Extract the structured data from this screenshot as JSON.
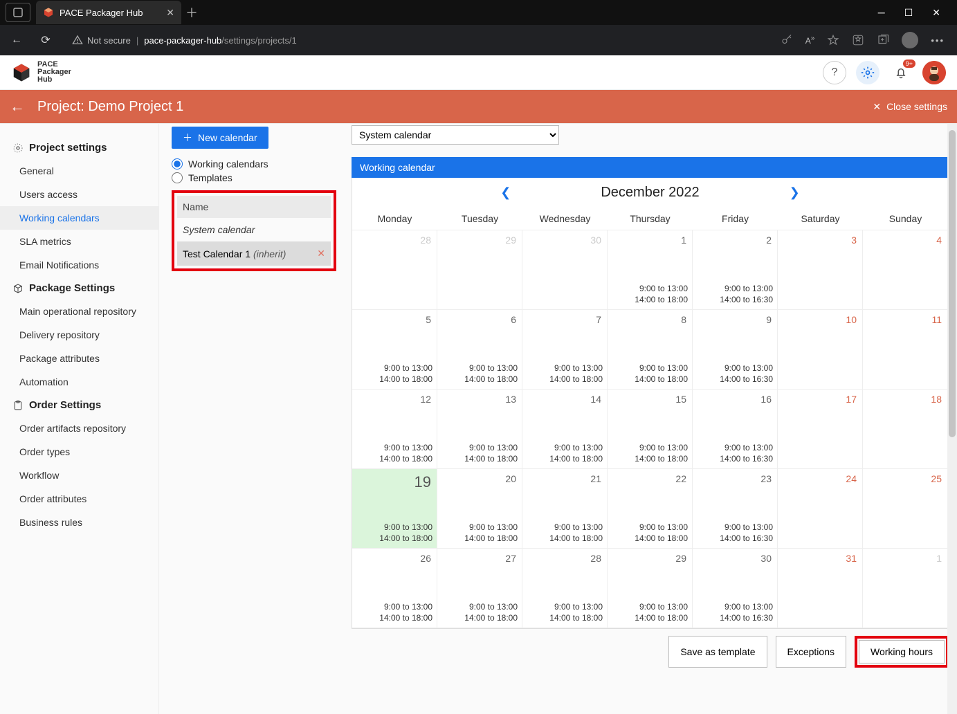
{
  "browser": {
    "tab_title": "PACE Packager Hub",
    "not_secure": "Not secure",
    "url_host": "pace-packager-hub",
    "url_path": "/settings/projects/1"
  },
  "app_header": {
    "brand1": "PACE",
    "brand2": "Packager",
    "brand3": "Hub",
    "notif_badge": "9+"
  },
  "project_bar": {
    "title": "Project: Demo Project 1",
    "close": "Close settings"
  },
  "sidebar": {
    "sec_project": "Project settings",
    "items_project": [
      "General",
      "Users access",
      "Working calendars",
      "SLA metrics",
      "Email Notifications"
    ],
    "sec_package": "Package Settings",
    "items_package": [
      "Main operational repository",
      "Delivery repository",
      "Package attributes",
      "Automation"
    ],
    "sec_order": "Order Settings",
    "items_order": [
      "Order artifacts repository",
      "Order types",
      "Workflow",
      "Order attributes",
      "Business rules"
    ]
  },
  "middle": {
    "new_calendar": "New calendar",
    "radio_working": "Working calendars",
    "radio_templates": "Templates",
    "col_name": "Name",
    "system_calendar": "System calendar",
    "test_calendar": "Test Calendar 1",
    "inherit": "(inherit)"
  },
  "calendar": {
    "selector_value": "System calendar",
    "panel_title": "Working calendar",
    "month_label": "December 2022",
    "days": [
      "Monday",
      "Tuesday",
      "Wednesday",
      "Thursday",
      "Friday",
      "Saturday",
      "Sunday"
    ],
    "slotA": "9:00 to 13:00",
    "slotB": "14:00 to 18:00",
    "slotB_fri": "14:00 to 16:30",
    "save_template": "Save as template",
    "exceptions": "Exceptions",
    "working_hours": "Working hours",
    "cells": [
      {
        "n": "28",
        "cls": "other"
      },
      {
        "n": "29",
        "cls": "other"
      },
      {
        "n": "30",
        "cls": "other"
      },
      {
        "n": "1",
        "cls": "wd th"
      },
      {
        "n": "2",
        "cls": "wd fr"
      },
      {
        "n": "3",
        "cls": "weekend"
      },
      {
        "n": "4",
        "cls": "weekend"
      },
      {
        "n": "5",
        "cls": "wd"
      },
      {
        "n": "6",
        "cls": "wd"
      },
      {
        "n": "7",
        "cls": "wd"
      },
      {
        "n": "8",
        "cls": "wd"
      },
      {
        "n": "9",
        "cls": "wd fr"
      },
      {
        "n": "10",
        "cls": "weekend"
      },
      {
        "n": "11",
        "cls": "weekend"
      },
      {
        "n": "12",
        "cls": "wd"
      },
      {
        "n": "13",
        "cls": "wd"
      },
      {
        "n": "14",
        "cls": "wd"
      },
      {
        "n": "15",
        "cls": "wd"
      },
      {
        "n": "16",
        "cls": "wd fr"
      },
      {
        "n": "17",
        "cls": "weekend"
      },
      {
        "n": "18",
        "cls": "weekend"
      },
      {
        "n": "19",
        "cls": "wd today"
      },
      {
        "n": "20",
        "cls": "wd"
      },
      {
        "n": "21",
        "cls": "wd"
      },
      {
        "n": "22",
        "cls": "wd"
      },
      {
        "n": "23",
        "cls": "wd fr"
      },
      {
        "n": "24",
        "cls": "weekend"
      },
      {
        "n": "25",
        "cls": "weekend"
      },
      {
        "n": "26",
        "cls": "wd"
      },
      {
        "n": "27",
        "cls": "wd"
      },
      {
        "n": "28",
        "cls": "wd"
      },
      {
        "n": "29",
        "cls": "wd"
      },
      {
        "n": "30",
        "cls": "wd fr"
      },
      {
        "n": "31",
        "cls": "weekend"
      },
      {
        "n": "1",
        "cls": "other"
      }
    ]
  }
}
